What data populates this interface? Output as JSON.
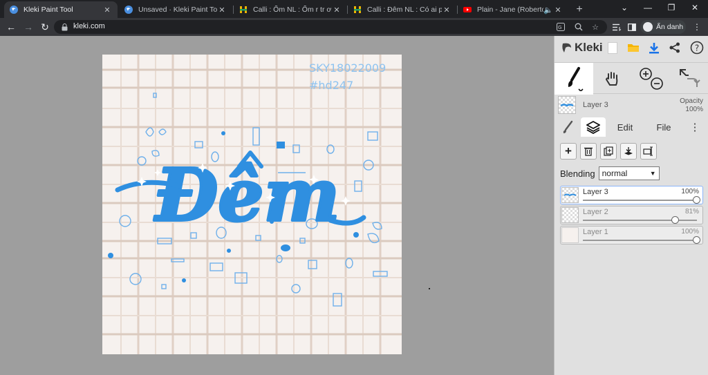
{
  "browser": {
    "tabs": [
      {
        "title": "Kleki Paint Tool",
        "favicon": "kleki-icon",
        "active": true
      },
      {
        "title": "Unsaved · Kleki Paint Tool",
        "favicon": "kleki-icon",
        "active": false
      },
      {
        "title": "Calli : Ốm NL : Ốm r tr ơi :D c",
        "favicon": "hoidap-icon",
        "active": false
      },
      {
        "title": "Calli : Đêm NL : Có ai phải th",
        "favicon": "hoidap-icon",
        "active": false
      },
      {
        "title": "Plain - Jane (Roberto Ka",
        "favicon": "youtube-icon",
        "active": false
      }
    ],
    "new_tab": "+",
    "url": "kleki.com",
    "profile_label": "Ẩn danh"
  },
  "kleki": {
    "logo_text": "Kleki",
    "current_layer_name": "Layer 3",
    "opacity_label": "Opacity",
    "opacity_value": "100%",
    "panel_tabs": [
      {
        "label": "Edit"
      },
      {
        "label": "File"
      }
    ],
    "blending_label": "Blending",
    "blending_value": "normal",
    "layers": [
      {
        "name": "Layer 3",
        "opacity": "100%",
        "opacity_value": 1.0,
        "active": true
      },
      {
        "name": "Layer 2",
        "opacity": "81%",
        "opacity_value": 0.81,
        "active": false
      },
      {
        "name": "Layer 1",
        "opacity": "100%",
        "opacity_value": 1.0,
        "active": false
      }
    ]
  },
  "artwork": {
    "watermark_line1": "SKY18022009",
    "watermark_line2": "#hd247",
    "main_word": "Đêm"
  },
  "colors": {
    "accent_blue": "#2f8fe0",
    "light_blue": "#8ec3f0",
    "download_blue": "#1a73e8"
  }
}
